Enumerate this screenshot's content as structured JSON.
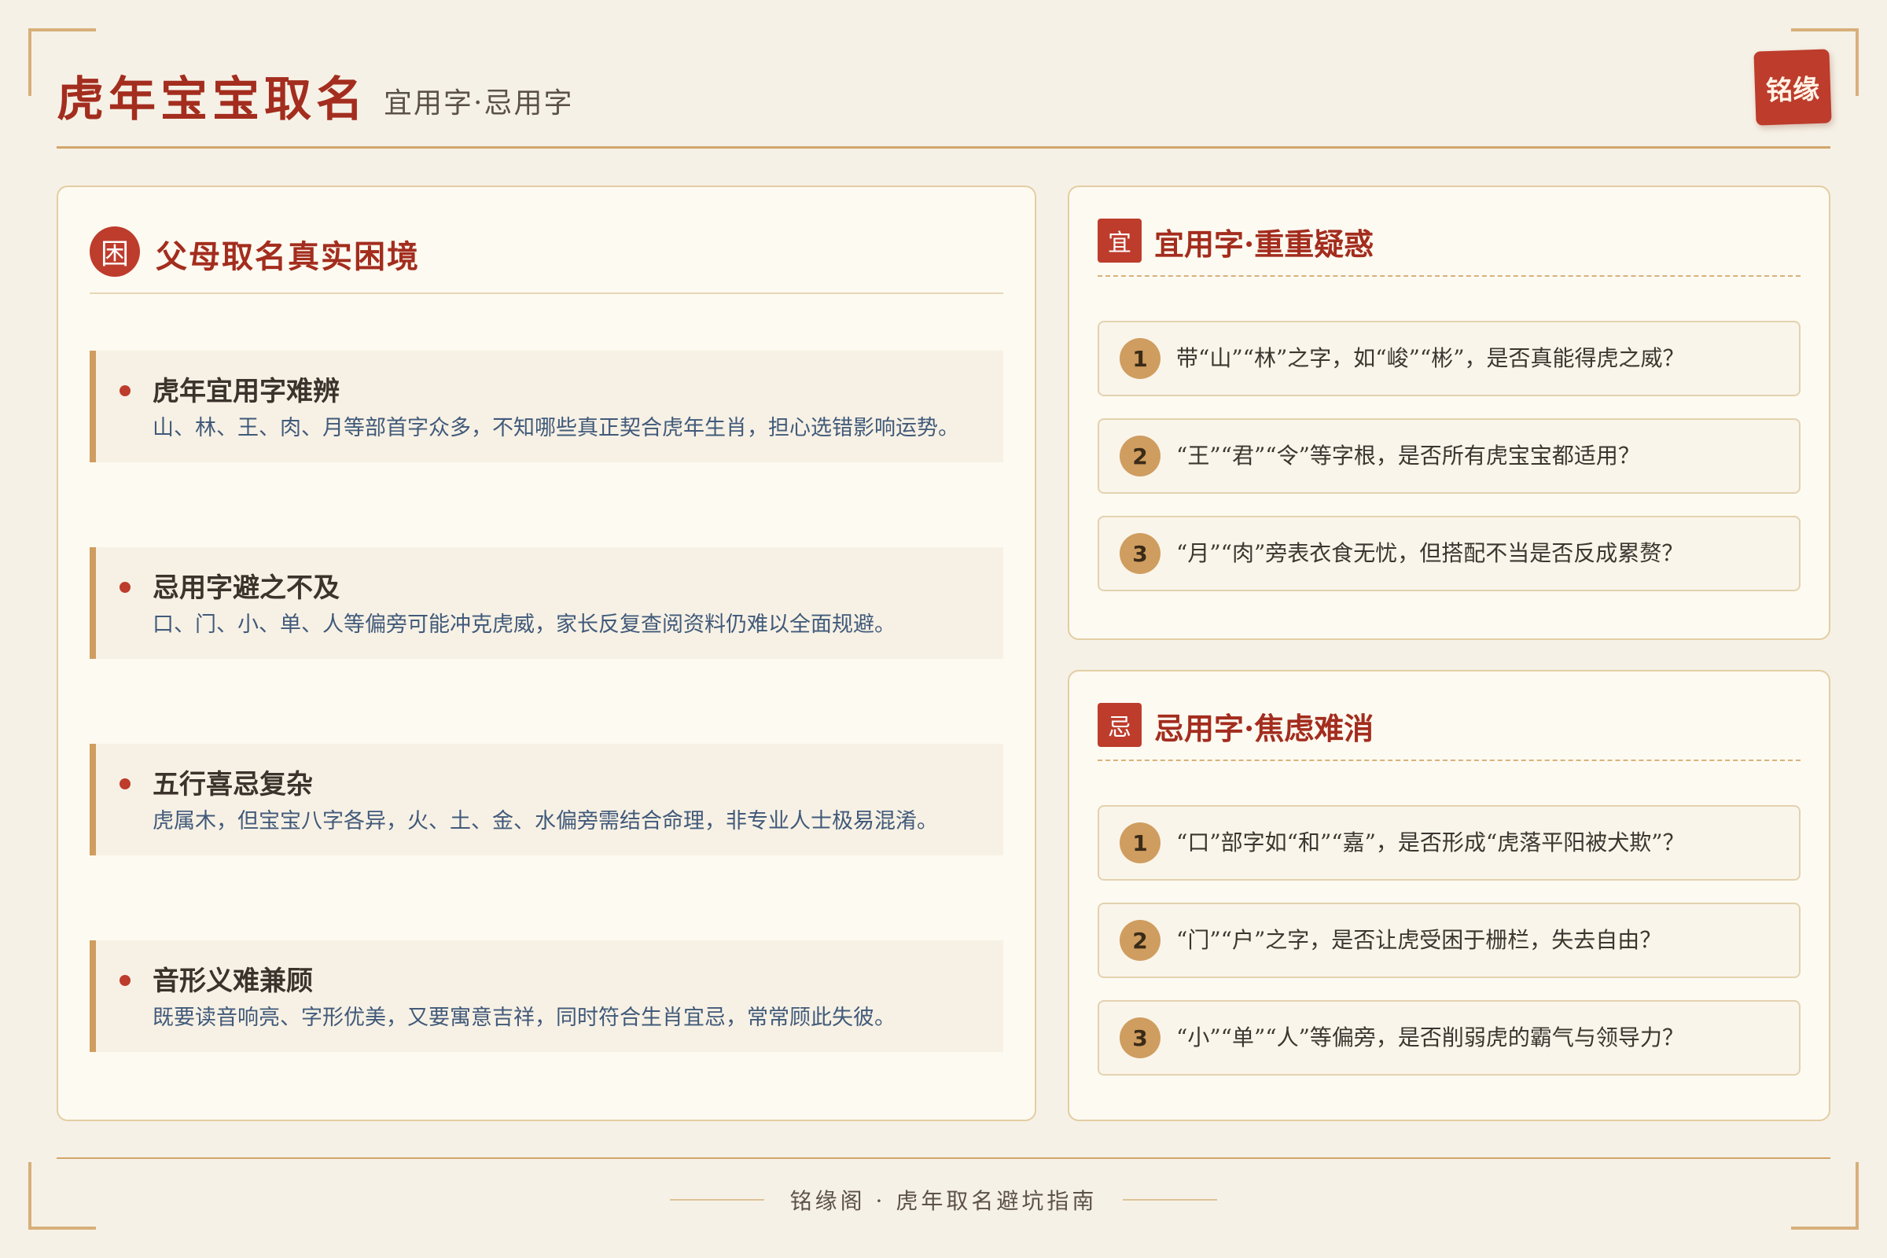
{
  "header": {
    "title": "虎年宝宝取名",
    "subtitle": "宜用字·忌用字",
    "seal": "铭缘"
  },
  "left": {
    "icon_char": "困",
    "title": "父母取名真实困境",
    "items": [
      {
        "heading": "虎年宜用字难辨",
        "desc": "山、林、王、肉、月等部首字众多，不知哪些真正契合虎年生肖，担心选错影响运势。"
      },
      {
        "heading": "忌用字避之不及",
        "desc": "口、门、小、单、人等偏旁可能冲克虎威，家长反复查阅资料仍难以全面规避。"
      },
      {
        "heading": "五行喜忌复杂",
        "desc": "虎属木，但宝宝八字各异，火、土、金、水偏旁需结合命理，非专业人士极易混淆。"
      },
      {
        "heading": "音形义难兼顾",
        "desc": "既要读音响亮、字形优美，又要寓意吉祥，同时符合生肖宜忌，常常顾此失彼。"
      }
    ]
  },
  "right_top": {
    "icon_char": "宜",
    "title": "宜用字·重重疑惑",
    "questions": [
      {
        "num": "1",
        "text": "带“山”“林”之字，如“峻”“彬”，是否真能得虎之威？"
      },
      {
        "num": "2",
        "text": "“王”“君”“令”等字根，是否所有虎宝宝都适用？"
      },
      {
        "num": "3",
        "text": "“月”“肉”旁表衣食无忧，但搭配不当是否反成累赘？"
      }
    ]
  },
  "right_bottom": {
    "icon_char": "忌",
    "title": "忌用字·焦虑难消",
    "questions": [
      {
        "num": "1",
        "text": "“口”部字如“和”“嘉”，是否形成“虎落平阳被犬欺”？"
      },
      {
        "num": "2",
        "text": "“门”“户”之字，是否让虎受困于栅栏，失去自由？"
      },
      {
        "num": "3",
        "text": "“小”“单”“人”等偏旁，是否削弱虎的霸气与领导力？"
      }
    ]
  },
  "footer": {
    "text": "铭缘阁 · 虎年取名避坑指南"
  },
  "colors": {
    "accent_red": "#bd3c2c",
    "title_red": "#a32d1e",
    "gold": "#cf9d5f",
    "background": "#f6f1e6"
  }
}
